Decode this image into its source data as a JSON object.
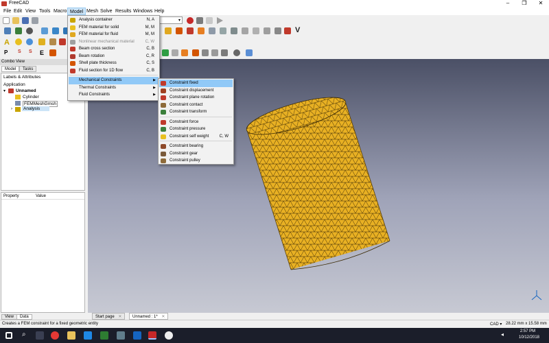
{
  "app": {
    "title": "FreeCAD"
  },
  "window_controls": {
    "minimize": "–",
    "maximize": "❐",
    "close": "✕"
  },
  "menubar": [
    "File",
    "Edit",
    "View",
    "Tools",
    "Macro",
    "Model",
    "Mesh",
    "Solve",
    "Results",
    "Windows",
    "Help"
  ],
  "model_menu": [
    {
      "label": "Analysis container",
      "shortcut": "N, A",
      "icon": "analysis-icon"
    },
    {
      "label": "FEM material for solid",
      "shortcut": "M, M",
      "icon": "material-solid-icon"
    },
    {
      "label": "FEM material for fluid",
      "shortcut": "M, M",
      "icon": "material-fluid-icon"
    },
    {
      "label": "Nonlinear mechanical material",
      "shortcut": "C, W",
      "icon": "nonlinear-material-icon",
      "disabled": true
    },
    {
      "label": "Beam cross section",
      "shortcut": "C, B",
      "icon": "beam-section-icon"
    },
    {
      "label": "Beam rotation",
      "shortcut": "C, R",
      "icon": "beam-rotation-icon"
    },
    {
      "label": "Shell plate thickness",
      "shortcut": "C, S",
      "icon": "shell-thickness-icon"
    },
    {
      "label": "Fluid section for 1D flow",
      "shortcut": "C, B",
      "icon": "fluid-section-icon"
    },
    {
      "label": "Mechanical Constraints",
      "submenu": true
    },
    {
      "label": "Thermal Constraints",
      "submenu": true
    },
    {
      "label": "Fluid Constraints",
      "submenu": true
    }
  ],
  "mech_submenu": [
    {
      "label": "Constraint fixed",
      "icon": "constraint-fixed-icon"
    },
    {
      "label": "Constraint displacement",
      "icon": "constraint-displacement-icon"
    },
    {
      "label": "Constraint plane rotation",
      "icon": "constraint-plane-rotation-icon"
    },
    {
      "label": "Constraint contact",
      "icon": "constraint-contact-icon"
    },
    {
      "label": "Constraint transform",
      "icon": "constraint-transform-icon"
    },
    {
      "label": "Constraint force",
      "icon": "constraint-force-icon"
    },
    {
      "label": "Constraint pressure",
      "icon": "constraint-pressure-icon"
    },
    {
      "label": "Constraint self weight",
      "shortcut": "C, W",
      "icon": "constraint-self-weight-icon"
    },
    {
      "label": "Constraint bearing",
      "icon": "constraint-bearing-icon"
    },
    {
      "label": "Constraint gear",
      "icon": "constraint-gear-icon"
    },
    {
      "label": "Constraint pulley",
      "icon": "constraint-pulley-icon"
    }
  ],
  "combo": {
    "title": "Combo View",
    "tabs": [
      "Model",
      "Tasks"
    ],
    "labels_header": "Labels & Attributes",
    "application": "Application",
    "document": "Unnamed",
    "tree_items": [
      "Cylinder",
      "FEMMeshGmsh",
      "Analysis"
    ],
    "props_cols": [
      "Property",
      "Value"
    ],
    "bottom_tabs": [
      "View",
      "Data"
    ]
  },
  "doc_tabs": [
    "Start page",
    "Unnamed : 1*"
  ],
  "status": {
    "message": "Creates a FEM constraint for a fixed geometric entity",
    "nav": "CAD",
    "dims": "28.22 mm x 15.58 mm"
  },
  "taskbar": {
    "time": "2:57 PM",
    "date": "10/12/2018"
  },
  "colors": {
    "mesh_fill": "#e8b023",
    "mesh_edge": "#3b2a05",
    "menu_highlight": "#91c9f7"
  }
}
